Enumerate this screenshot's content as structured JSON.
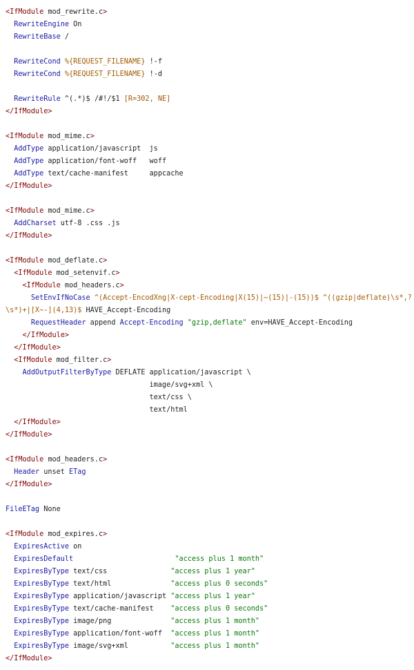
{
  "colors": {
    "tag": "#800000",
    "directive": "#1a1aa6",
    "string": "#0a7a0a",
    "variable": "#a05a00",
    "text": "#222222",
    "background": "#ffffff"
  },
  "lines": [
    [
      [
        "tag",
        "<IfModule "
      ],
      [
        "txt",
        "mod_rewrite.c"
      ],
      [
        "tag",
        ">"
      ]
    ],
    [
      [
        "txt",
        "  "
      ],
      [
        "dir",
        "RewriteEngine"
      ],
      [
        "txt",
        " On"
      ]
    ],
    [
      [
        "txt",
        "  "
      ],
      [
        "dir",
        "RewriteBase"
      ],
      [
        "txt",
        " /"
      ]
    ],
    [],
    [
      [
        "txt",
        "  "
      ],
      [
        "dir",
        "RewriteCond"
      ],
      [
        "txt",
        " "
      ],
      [
        "var",
        "%{REQUEST_FILENAME}"
      ],
      [
        "txt",
        " !-f"
      ]
    ],
    [
      [
        "txt",
        "  "
      ],
      [
        "dir",
        "RewriteCond"
      ],
      [
        "txt",
        " "
      ],
      [
        "var",
        "%{REQUEST_FILENAME}"
      ],
      [
        "txt",
        " !-d"
      ]
    ],
    [],
    [
      [
        "txt",
        "  "
      ],
      [
        "dir",
        "RewriteRule"
      ],
      [
        "txt",
        " ^(.*)$ /#!/$1 "
      ],
      [
        "var",
        "[R=302, NE]"
      ]
    ],
    [
      [
        "tag",
        "</IfModule>"
      ]
    ],
    [],
    [
      [
        "tag",
        "<IfModule "
      ],
      [
        "txt",
        "mod_mime.c"
      ],
      [
        "tag",
        ">"
      ]
    ],
    [
      [
        "txt",
        "  "
      ],
      [
        "dir",
        "AddType"
      ],
      [
        "txt",
        " application/javascript  js"
      ]
    ],
    [
      [
        "txt",
        "  "
      ],
      [
        "dir",
        "AddType"
      ],
      [
        "txt",
        " application/font-woff   woff"
      ]
    ],
    [
      [
        "txt",
        "  "
      ],
      [
        "dir",
        "AddType"
      ],
      [
        "txt",
        " text/cache-manifest     appcache"
      ]
    ],
    [
      [
        "tag",
        "</IfModule>"
      ]
    ],
    [],
    [
      [
        "tag",
        "<IfModule "
      ],
      [
        "txt",
        "mod_mime.c"
      ],
      [
        "tag",
        ">"
      ]
    ],
    [
      [
        "txt",
        "  "
      ],
      [
        "dir",
        "AddCharset"
      ],
      [
        "txt",
        " utf-8 .css .js"
      ]
    ],
    [
      [
        "tag",
        "</IfModule>"
      ]
    ],
    [],
    [
      [
        "tag",
        "<IfModule "
      ],
      [
        "txt",
        "mod_deflate.c"
      ],
      [
        "tag",
        ">"
      ]
    ],
    [
      [
        "txt",
        "  "
      ],
      [
        "tag",
        "<IfModule "
      ],
      [
        "txt",
        "mod_setenvif.c"
      ],
      [
        "tag",
        ">"
      ]
    ],
    [
      [
        "txt",
        "    "
      ],
      [
        "tag",
        "<IfModule "
      ],
      [
        "txt",
        "mod_headers.c"
      ],
      [
        "tag",
        ">"
      ]
    ],
    [
      [
        "txt",
        "      "
      ],
      [
        "dir",
        "SetEnvIfNoCase"
      ],
      [
        "txt",
        " "
      ],
      [
        "var",
        "^(Accept-EncodXng|X-cept-Encoding|X(15)|~(15)|-(15))$"
      ],
      [
        "txt",
        " "
      ],
      [
        "var",
        "^((gzip|deflate)\\s*,?"
      ]
    ],
    [
      [
        "var",
        "\\s*)+|[X~-](4,13)$"
      ],
      [
        "txt",
        " HAVE_Accept-Encoding"
      ]
    ],
    [
      [
        "txt",
        "      "
      ],
      [
        "dir",
        "RequestHeader"
      ],
      [
        "txt",
        " append "
      ],
      [
        "dir",
        "Accept-Encoding"
      ],
      [
        "txt",
        " "
      ],
      [
        "str",
        "\"gzip,deflate\""
      ],
      [
        "txt",
        " env=HAVE_Accept-Encoding"
      ]
    ],
    [
      [
        "txt",
        "    "
      ],
      [
        "tag",
        "</IfModule>"
      ]
    ],
    [
      [
        "txt",
        "  "
      ],
      [
        "tag",
        "</IfModule>"
      ]
    ],
    [
      [
        "txt",
        "  "
      ],
      [
        "tag",
        "<IfModule "
      ],
      [
        "txt",
        "mod_filter.c"
      ],
      [
        "tag",
        ">"
      ]
    ],
    [
      [
        "txt",
        "    "
      ],
      [
        "dir",
        "AddOutputFilterByType"
      ],
      [
        "txt",
        " DEFLATE application/javascript \\"
      ]
    ],
    [
      [
        "txt",
        "                                  image/svg+xml \\"
      ]
    ],
    [
      [
        "txt",
        "                                  text/css \\"
      ]
    ],
    [
      [
        "txt",
        "                                  text/html"
      ]
    ],
    [
      [
        "txt",
        "  "
      ],
      [
        "tag",
        "</IfModule>"
      ]
    ],
    [
      [
        "tag",
        "</IfModule>"
      ]
    ],
    [],
    [
      [
        "tag",
        "<IfModule "
      ],
      [
        "txt",
        "mod_headers.c"
      ],
      [
        "tag",
        ">"
      ]
    ],
    [
      [
        "txt",
        "  "
      ],
      [
        "dir",
        "Header"
      ],
      [
        "txt",
        " unset "
      ],
      [
        "dir",
        "ETag"
      ]
    ],
    [
      [
        "tag",
        "</IfModule>"
      ]
    ],
    [],
    [
      [
        "dir",
        "FileETag"
      ],
      [
        "txt",
        " None"
      ]
    ],
    [],
    [
      [
        "tag",
        "<IfModule "
      ],
      [
        "txt",
        "mod_expires.c"
      ],
      [
        "tag",
        ">"
      ]
    ],
    [
      [
        "txt",
        "  "
      ],
      [
        "dir",
        "ExpiresActive"
      ],
      [
        "txt",
        " on"
      ]
    ],
    [
      [
        "txt",
        "  "
      ],
      [
        "dir",
        "ExpiresDefault"
      ],
      [
        "txt",
        "                        "
      ],
      [
        "str",
        "\"access plus 1 month\""
      ]
    ],
    [
      [
        "txt",
        "  "
      ],
      [
        "dir",
        "ExpiresByType"
      ],
      [
        "txt",
        " text/css               "
      ],
      [
        "str",
        "\"access plus 1 year\""
      ]
    ],
    [
      [
        "txt",
        "  "
      ],
      [
        "dir",
        "ExpiresByType"
      ],
      [
        "txt",
        " text/html              "
      ],
      [
        "str",
        "\"access plus 0 seconds\""
      ]
    ],
    [
      [
        "txt",
        "  "
      ],
      [
        "dir",
        "ExpiresByType"
      ],
      [
        "txt",
        " application/javascript "
      ],
      [
        "str",
        "\"access plus 1 year\""
      ]
    ],
    [
      [
        "txt",
        "  "
      ],
      [
        "dir",
        "ExpiresByType"
      ],
      [
        "txt",
        " text/cache-manifest    "
      ],
      [
        "str",
        "\"access plus 0 seconds\""
      ]
    ],
    [
      [
        "txt",
        "  "
      ],
      [
        "dir",
        "ExpiresByType"
      ],
      [
        "txt",
        " image/png              "
      ],
      [
        "str",
        "\"access plus 1 month\""
      ]
    ],
    [
      [
        "txt",
        "  "
      ],
      [
        "dir",
        "ExpiresByType"
      ],
      [
        "txt",
        " application/font-woff  "
      ],
      [
        "str",
        "\"access plus 1 month\""
      ]
    ],
    [
      [
        "txt",
        "  "
      ],
      [
        "dir",
        "ExpiresByType"
      ],
      [
        "txt",
        " image/svg+xml          "
      ],
      [
        "str",
        "\"access plus 1 month\""
      ]
    ],
    [
      [
        "tag",
        "</IfModule>"
      ]
    ]
  ]
}
